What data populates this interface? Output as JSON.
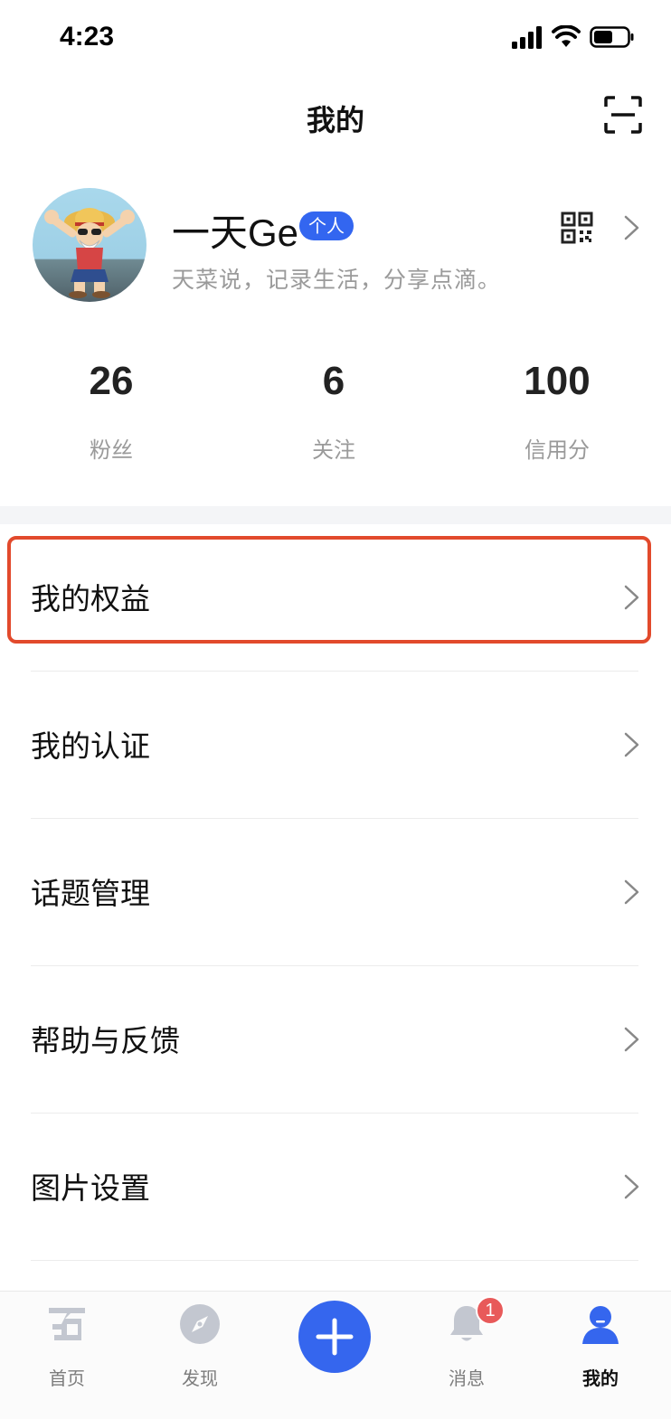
{
  "status_bar": {
    "time": "4:23",
    "icons": [
      "cellular-signal-icon",
      "wifi-icon",
      "battery-icon"
    ]
  },
  "header": {
    "title": "我的",
    "scan_icon": "scan-icon"
  },
  "profile": {
    "name": "一天Ge",
    "badge": "个人",
    "bio": "天菜说，记录生活，分享点滴。",
    "qr_icon": "qr-code-icon"
  },
  "stats": [
    {
      "value": "26",
      "label": "粉丝"
    },
    {
      "value": "6",
      "label": "关注"
    },
    {
      "value": "100",
      "label": "信用分"
    }
  ],
  "menu": {
    "items": [
      {
        "label": "我的权益"
      },
      {
        "label": "我的认证"
      },
      {
        "label": "话题管理"
      },
      {
        "label": "帮助与反馈"
      },
      {
        "label": "图片设置"
      }
    ],
    "highlighted_index": 0
  },
  "tabbar": {
    "tabs": [
      {
        "label": "首页",
        "icon": "home-icon"
      },
      {
        "label": "发现",
        "icon": "compass-icon"
      },
      {
        "label": "消息",
        "icon": "bell-icon",
        "badge": "1"
      },
      {
        "label": "我的",
        "icon": "profile-icon",
        "active": true
      }
    ],
    "add_icon": "plus-icon"
  },
  "colors": {
    "accent": "#3566ee",
    "highlight_border": "#e24a2c",
    "notification": "#e85a5a"
  }
}
